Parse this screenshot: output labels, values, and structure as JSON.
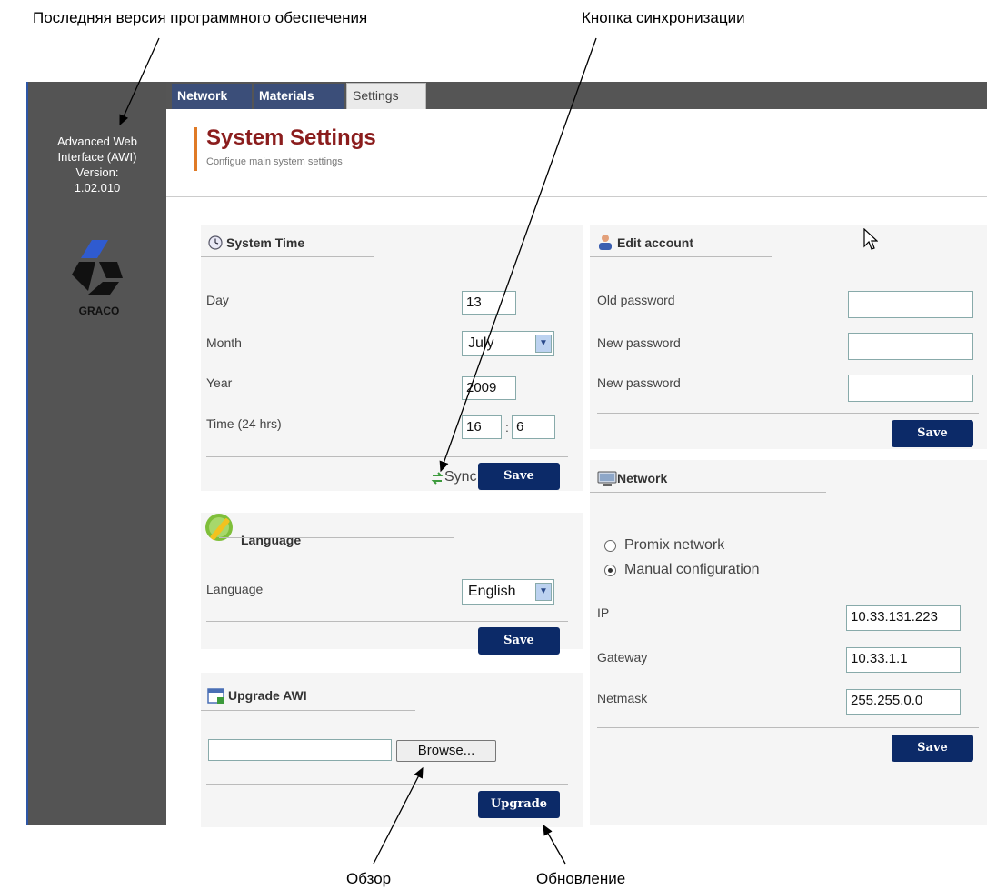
{
  "callouts": {
    "firmware": "Последняя версия программного обеспечения",
    "sync": "Кнопка синхронизации",
    "browse": "Обзор",
    "upgrade": "Обновление"
  },
  "sidebar": {
    "line1": "Advanced Web",
    "line2": "Interface (AWI)",
    "line3": "Version:",
    "line4": "1.02.010",
    "logo_text": "GRACO"
  },
  "tabs": {
    "network": "Network",
    "materials": "Materials",
    "settings": "Settings"
  },
  "header": {
    "title": "System Settings",
    "subtitle": "Configue main system settings"
  },
  "system_time": {
    "title": "System Time",
    "day_label": "Day",
    "day_value": "13",
    "month_label": "Month",
    "month_value": "July",
    "year_label": "Year",
    "year_value": "2009",
    "time_label": "Time (24 hrs)",
    "hour_value": "16",
    "colon": ":",
    "minute_value": "6",
    "sync_label": "Sync I",
    "save_label": "Save"
  },
  "language": {
    "title": "Language",
    "label": "Language",
    "value": "English",
    "save_label": "Save"
  },
  "upgrade": {
    "title": "Upgrade AWI",
    "file_value": "",
    "browse_label": "Browse...",
    "upgrade_label": "Upgrade"
  },
  "account": {
    "title": "Edit account",
    "old_label": "Old password",
    "new_label": "New password",
    "new2_label": "New password",
    "save_label": "Save"
  },
  "network": {
    "title": "Network",
    "opt1": "Promix network",
    "opt2": "Manual configuration",
    "ip_label": "IP",
    "ip_value": "10.33.131.223",
    "gw_label": "Gateway",
    "gw_value": "10.33.1.1",
    "mask_label": "Netmask",
    "mask_value": "255.255.0.0",
    "save_label": "Save"
  },
  "colors": {
    "accent": "#8b1d1d",
    "button": "#0c2a68",
    "sidebar": "#545454",
    "tab": "#3b4e79"
  }
}
